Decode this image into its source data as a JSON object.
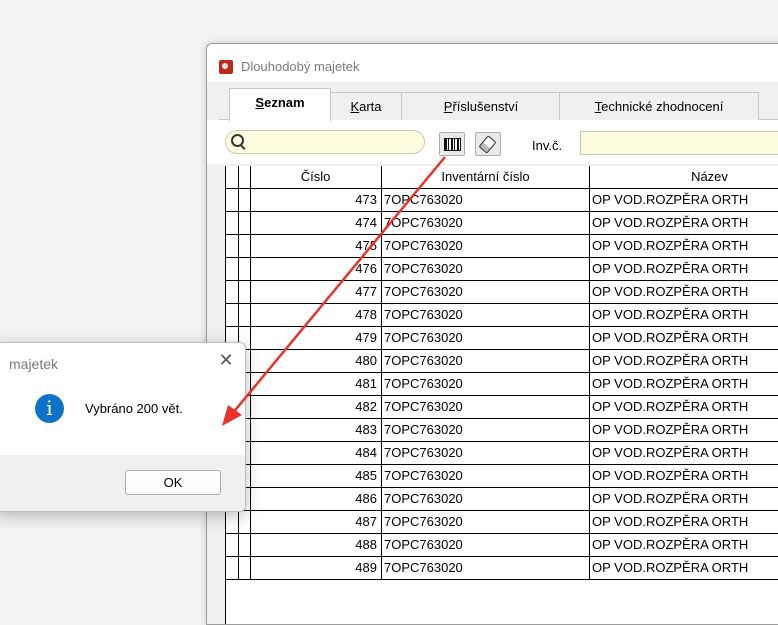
{
  "window": {
    "title": "Dlouhodobý majetek"
  },
  "tabs": [
    {
      "label": "Seznam",
      "active": true
    },
    {
      "label": "Karta",
      "active": false
    },
    {
      "label": "Příslušenství",
      "active": false
    },
    {
      "label": "Technické zhodnocení",
      "active": false
    }
  ],
  "toolbar": {
    "search_value": "",
    "inv_label": "Inv.č.",
    "inv_value": ""
  },
  "table": {
    "columns": [
      "Číslo",
      "Inventární číslo",
      "Název"
    ],
    "rows": [
      [
        "473",
        "7OPC763020",
        "OP VOD.ROZPĚRA ORTH"
      ],
      [
        "474",
        "7OPC763020",
        "OP VOD.ROZPĚRA ORTH"
      ],
      [
        "475",
        "7OPC763020",
        "OP VOD.ROZPĚRA ORTH"
      ],
      [
        "476",
        "7OPC763020",
        "OP VOD.ROZPĚRA ORTH"
      ],
      [
        "477",
        "7OPC763020",
        "OP VOD.ROZPĚRA ORTH"
      ],
      [
        "478",
        "7OPC763020",
        "OP VOD.ROZPĚRA ORTH"
      ],
      [
        "479",
        "7OPC763020",
        "OP VOD.ROZPĚRA ORTH"
      ],
      [
        "480",
        "7OPC763020",
        "OP VOD.ROZPĚRA ORTH"
      ],
      [
        "481",
        "7OPC763020",
        "OP VOD.ROZPĚRA ORTH"
      ],
      [
        "482",
        "7OPC763020",
        "OP VOD.ROZPĚRA ORTH"
      ],
      [
        "483",
        "7OPC763020",
        "OP VOD.ROZPĚRA ORTH"
      ],
      [
        "484",
        "7OPC763020",
        "OP VOD.ROZPĚRA ORTH"
      ],
      [
        "485",
        "7OPC763020",
        "OP VOD.ROZPĚRA ORTH"
      ],
      [
        "486",
        "7OPC763020",
        "OP VOD.ROZPĚRA ORTH"
      ],
      [
        "487",
        "7OPC763020",
        "OP VOD.ROZPĚRA ORTH"
      ],
      [
        "488",
        "7OPC763020",
        "OP VOD.ROZPĚRA ORTH"
      ],
      [
        "489",
        "7OPC763020",
        "OP VOD.ROZPĚRA ORTH"
      ]
    ]
  },
  "dialog": {
    "title": "majetek",
    "close_glyph": "✕",
    "icon": "info-icon",
    "icon_glyph": "i",
    "message": "Vybráno 200 vět.",
    "ok_label": "OK"
  },
  "colors": {
    "annotation_arrow": "#e8322a",
    "info_icon": "#0e72c8",
    "input_bg": "#fffde0"
  }
}
